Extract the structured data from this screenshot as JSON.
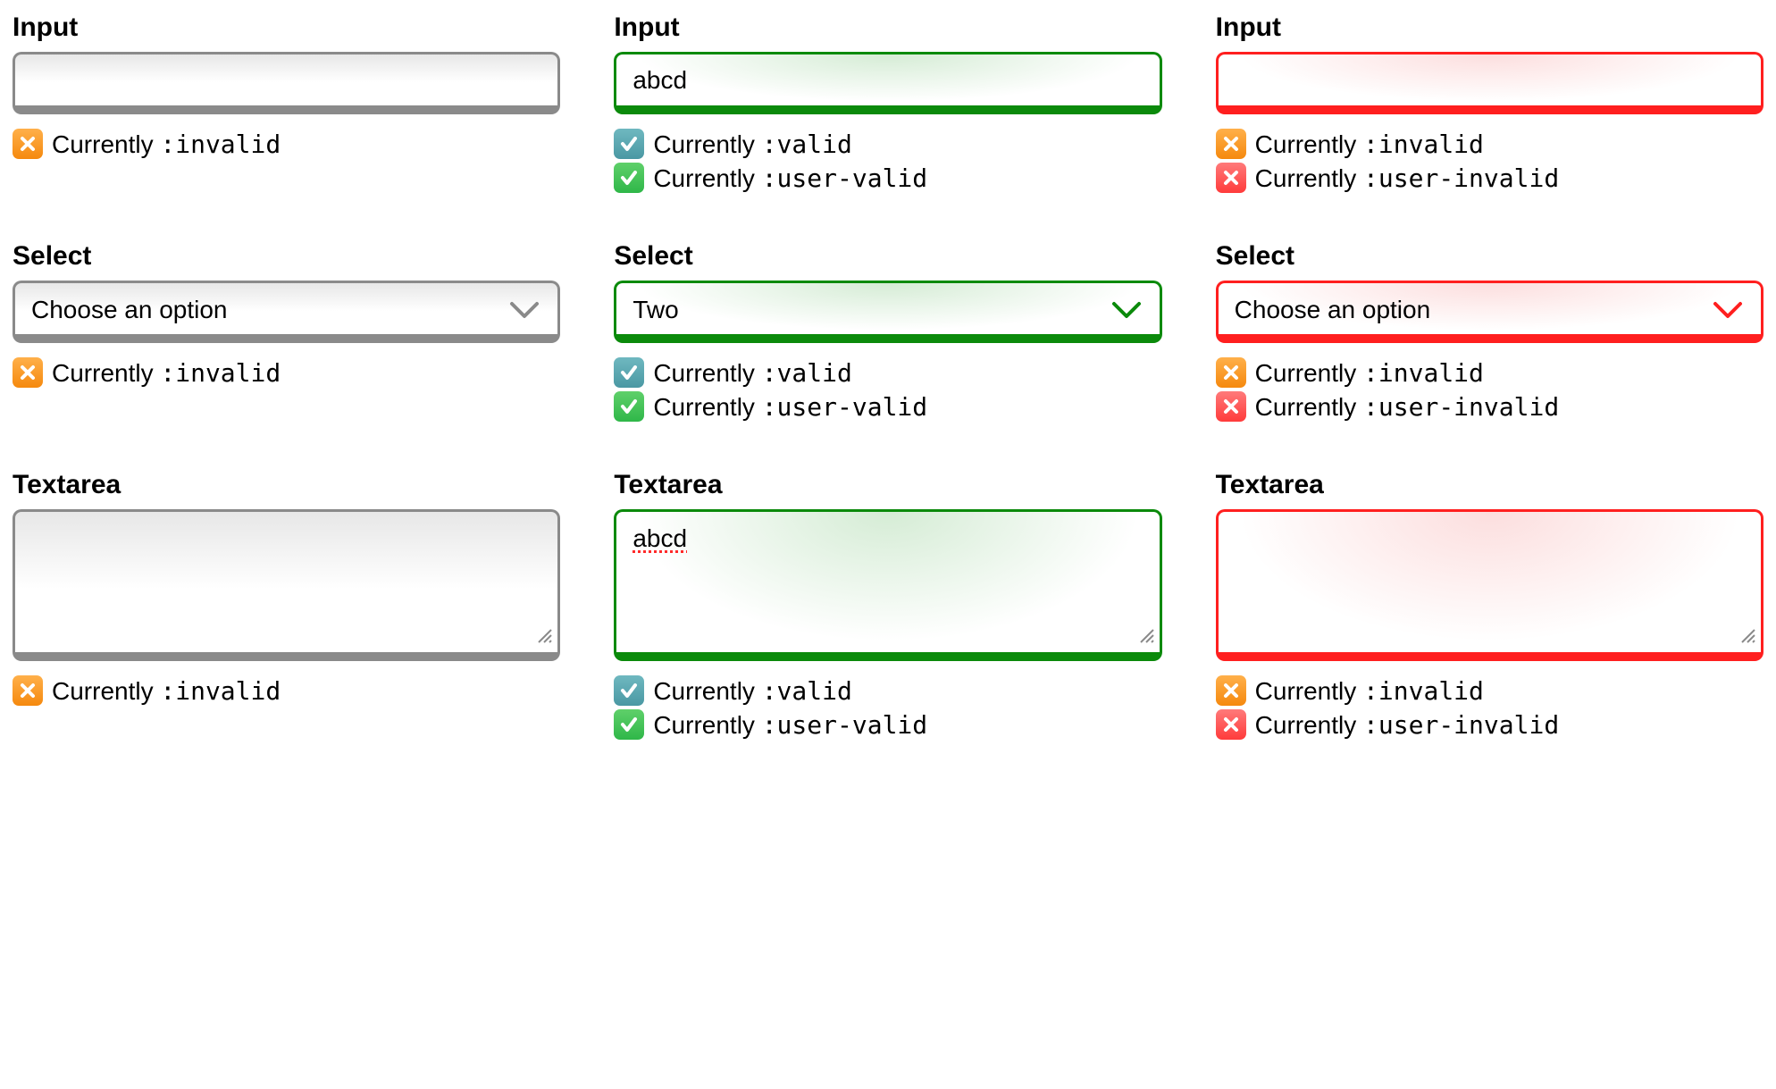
{
  "labels": {
    "input": "Input",
    "select": "Select",
    "textarea": "Textarea"
  },
  "status_text": {
    "prefix": "Currently ",
    "invalid": ":invalid",
    "valid": ":valid",
    "user_valid": ":user-valid",
    "user_invalid": ":user-invalid"
  },
  "col1": {
    "input_value": "",
    "select_value": "Choose an option",
    "textarea_value": "",
    "input_status": [
      {
        "icon": "orange-x",
        "pseudo": "invalid"
      }
    ],
    "select_status": [
      {
        "icon": "orange-x",
        "pseudo": "invalid"
      }
    ],
    "textarea_status": [
      {
        "icon": "orange-x",
        "pseudo": "invalid"
      }
    ]
  },
  "col2": {
    "input_value": "abcd",
    "select_value": "Two",
    "textarea_value": "abcd",
    "input_status": [
      {
        "icon": "teal-check",
        "pseudo": "valid"
      },
      {
        "icon": "green-check",
        "pseudo": "user_valid"
      }
    ],
    "select_status": [
      {
        "icon": "teal-check",
        "pseudo": "valid"
      },
      {
        "icon": "green-check",
        "pseudo": "user_valid"
      }
    ],
    "textarea_status": [
      {
        "icon": "teal-check",
        "pseudo": "valid"
      },
      {
        "icon": "green-check",
        "pseudo": "user_valid"
      }
    ]
  },
  "col3": {
    "input_value": "",
    "select_value": "Choose an option",
    "textarea_value": "",
    "input_status": [
      {
        "icon": "orange-x",
        "pseudo": "invalid"
      },
      {
        "icon": "red-x",
        "pseudo": "user_invalid"
      }
    ],
    "select_status": [
      {
        "icon": "orange-x",
        "pseudo": "invalid"
      },
      {
        "icon": "red-x",
        "pseudo": "user_invalid"
      }
    ],
    "textarea_status": [
      {
        "icon": "orange-x",
        "pseudo": "invalid"
      },
      {
        "icon": "red-x",
        "pseudo": "user_invalid"
      }
    ]
  },
  "colors": {
    "neutral_border": "#8a8a8a",
    "valid_border": "#0b8a0b",
    "invalid_border": "#ff1f1f"
  }
}
